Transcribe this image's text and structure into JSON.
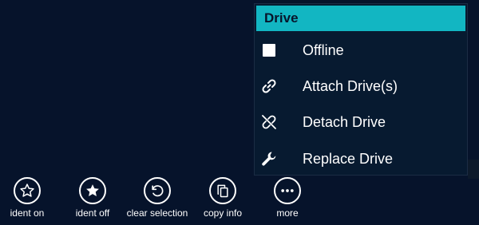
{
  "menu": {
    "title": "Drive",
    "items": [
      {
        "label": "Offline",
        "icon": "square-icon"
      },
      {
        "label": "Attach Drive(s)",
        "icon": "link-icon"
      },
      {
        "label": "Detach Drive",
        "icon": "unlink-icon"
      },
      {
        "label": "Replace Drive",
        "icon": "wrench-icon"
      }
    ]
  },
  "toolbar": {
    "buttons": [
      {
        "label": "ident on",
        "icon": "star-outline-icon"
      },
      {
        "label": "ident off",
        "icon": "star-filled-icon"
      },
      {
        "label": "clear selection",
        "icon": "undo-icon"
      },
      {
        "label": "copy info",
        "icon": "copy-icon"
      },
      {
        "label": "more",
        "icon": "more-icon"
      }
    ]
  },
  "colors": {
    "background": "#06132b",
    "menu_header": "#12b6c2",
    "menu_background": "#071a30"
  }
}
